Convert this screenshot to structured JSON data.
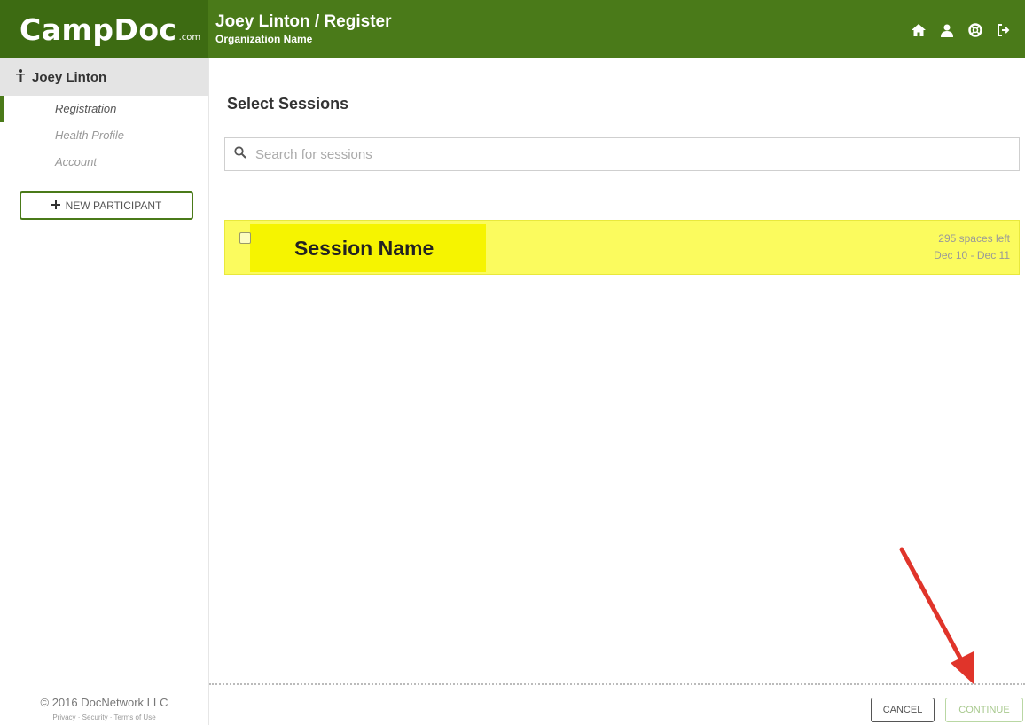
{
  "header": {
    "logo_main": "CampDoc",
    "logo_sub": ".com",
    "title": "Joey Linton / Register",
    "organization": "Organization Name",
    "icons": [
      "home-icon",
      "user-icon",
      "help-icon",
      "logout-icon"
    ],
    "background_color": "#4a7a19"
  },
  "sidebar": {
    "participant_name": "Joey Linton",
    "nav": [
      {
        "label": "Registration",
        "active": true
      },
      {
        "label": "Health Profile",
        "active": false
      },
      {
        "label": "Account",
        "active": false
      }
    ],
    "new_participant_label": "NEW PARTICIPANT",
    "footer_copyright": "© 2016 DocNetwork LLC",
    "footer_links": "Privacy · Security · Terms of Use"
  },
  "main": {
    "heading": "Select Sessions",
    "search_placeholder": "Search for sessions",
    "session": {
      "name": "Session Name",
      "spaces": "295 spaces left",
      "dates": "Dec 10 - Dec 11",
      "checked": false
    }
  },
  "footer": {
    "cancel_label": "CANCEL",
    "continue_label": "CONTINUE"
  },
  "annotation": {
    "arrow_color": "#e0342a"
  }
}
